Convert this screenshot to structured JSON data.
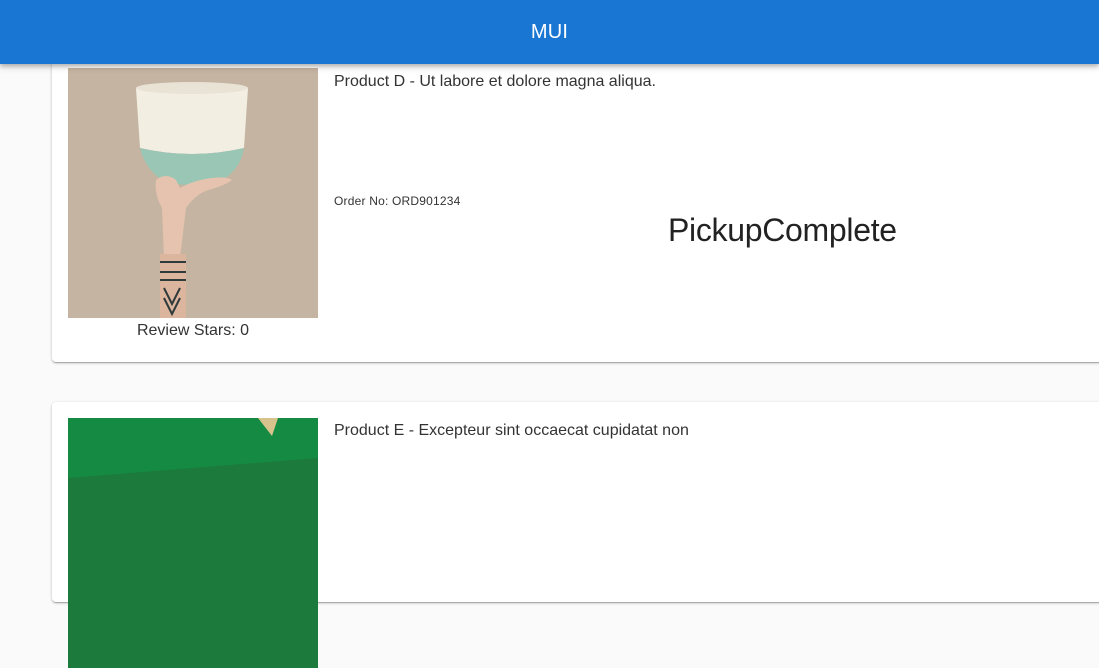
{
  "app_bar": {
    "title": "MUI",
    "color": "#1976d2"
  },
  "cards": [
    {
      "description": "Product D - Ut labore et dolore magna aliqua.",
      "order_number": "Order No: ORD901234",
      "status": "PickupComplete",
      "review_stars": "Review Stars: 0",
      "image": "bowl-in-hand-image"
    },
    {
      "description": "Product E - Excepteur sint occaecat cupidatat non",
      "image": "green-product-image"
    }
  ]
}
